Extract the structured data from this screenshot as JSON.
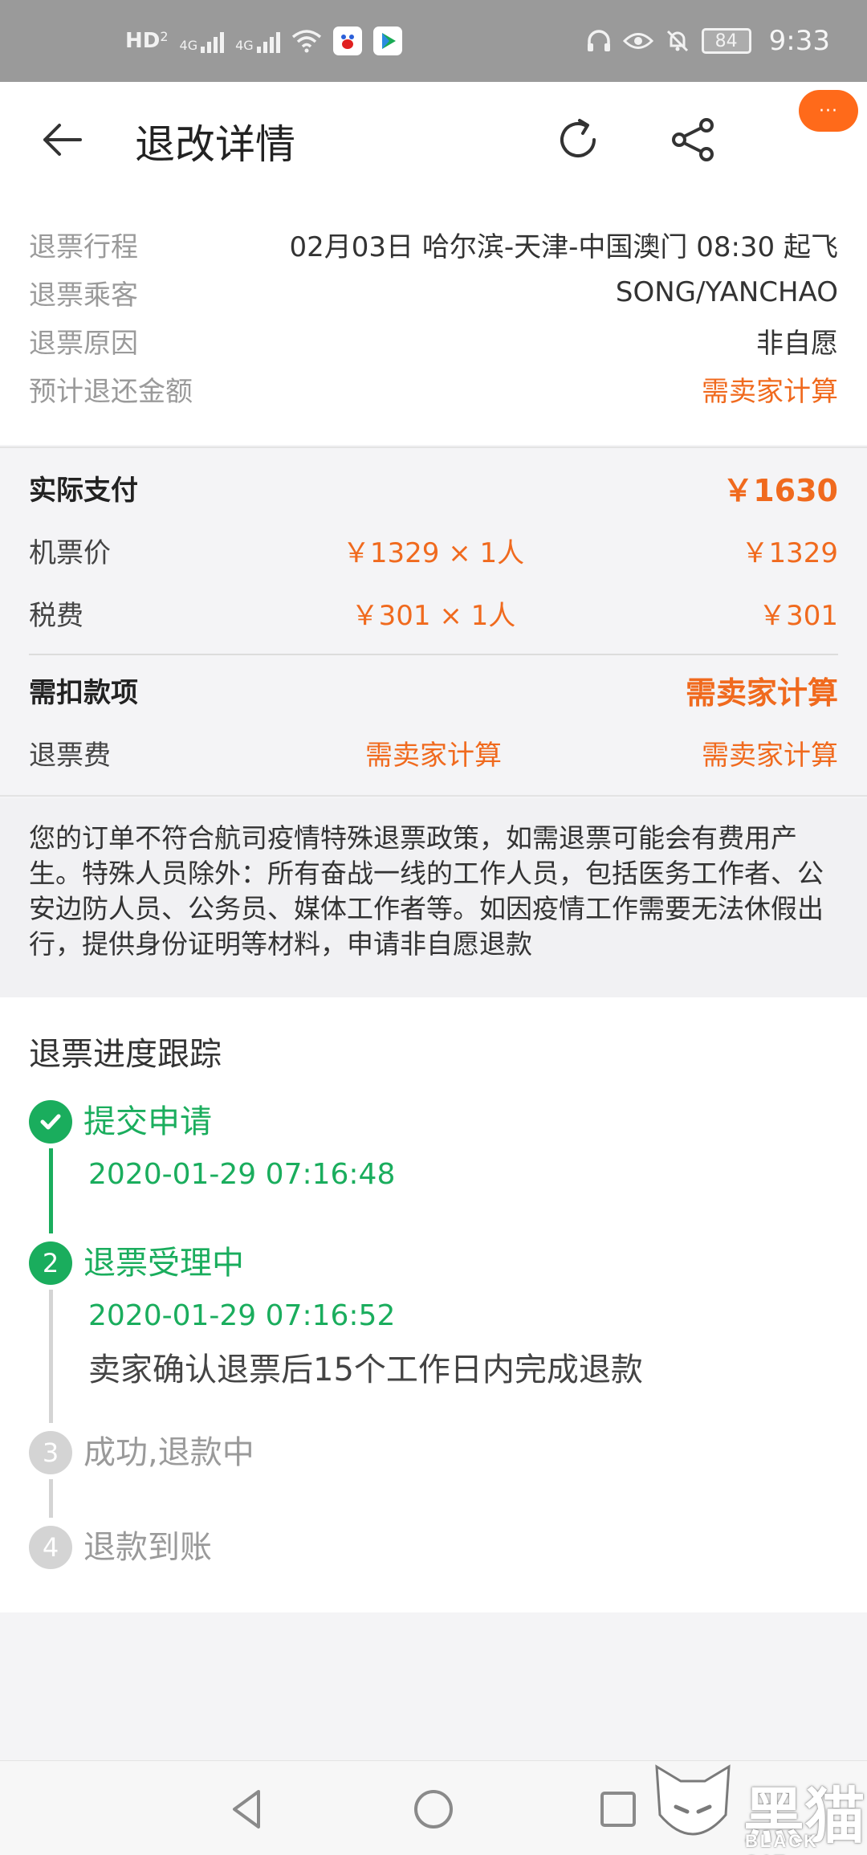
{
  "status_bar": {
    "hd_label": "HD",
    "hd_sub": "2",
    "network1": "4G",
    "network2": "4G",
    "battery": "84",
    "time": "9:33",
    "app1_icon": "baidu-icon",
    "app2_icon": "video-app-icon"
  },
  "header": {
    "title": "退改详情",
    "more_badge": "···"
  },
  "info": {
    "rows": [
      {
        "label": "退票行程",
        "value": "02月03日 哈尔滨-天津-中国澳门 08:30 起飞"
      },
      {
        "label": "退票乘客",
        "value": "SONG/YANCHAO"
      },
      {
        "label": "退票原因",
        "value": "非自愿"
      },
      {
        "label": "预计退还金额",
        "value": "需卖家计算"
      }
    ]
  },
  "price": {
    "actual_label": "实际支付",
    "actual_value": "￥1630",
    "ticket_label": "机票价",
    "ticket_calc": "￥1329 × 1人",
    "ticket_total": "￥1329",
    "tax_label": "税费",
    "tax_calc": "￥301 × 1人",
    "tax_total": "￥301",
    "deduct_label": "需扣款项",
    "deduct_value": "需卖家计算",
    "fee_label": "退票费",
    "fee_calc": "需卖家计算",
    "fee_total": "需卖家计算"
  },
  "notice": {
    "text": "您的订单不符合航司疫情特殊退票政策，如需退票可能会有费用产生。特殊人员除外：所有奋战一线的工作人员，包括医务工作者、公安边防人员、公务员、媒体工作者等。如因疫情工作需要无法休假出行，提供身份证明等材料，申请非自愿退款"
  },
  "progress": {
    "title": "退票进度跟踪",
    "steps": [
      {
        "number": "1",
        "title": "提交申请",
        "time": "2020-01-29 07:16:48",
        "status": "done"
      },
      {
        "number": "2",
        "title": "退票受理中",
        "time": "2020-01-29 07:16:52",
        "desc": "卖家确认退票后15个工作日内完成退款",
        "status": "current"
      },
      {
        "number": "3",
        "title": "成功,退款中",
        "status": "pending"
      },
      {
        "number": "4",
        "title": "退款到账",
        "status": "pending"
      }
    ]
  },
  "watermark": {
    "text": "黑猫",
    "sub": "BLACK CAT"
  },
  "colors": {
    "accent_orange": "#f06a1e",
    "success_green": "#1aad5d",
    "pending_gray": "#d4d4d4"
  }
}
